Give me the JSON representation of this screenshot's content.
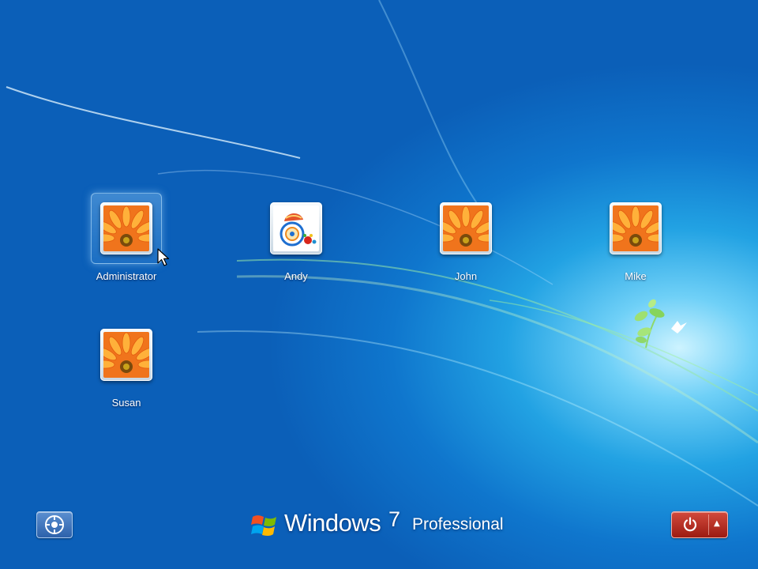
{
  "users": [
    {
      "name": "Administrator",
      "picture": "orange-flower-picture",
      "selected": true
    },
    {
      "name": "Andy",
      "picture": "fish-bowl-picture",
      "selected": false
    },
    {
      "name": "John",
      "picture": "orange-flower-picture",
      "selected": false
    },
    {
      "name": "Mike",
      "picture": "orange-flower-picture",
      "selected": false
    },
    {
      "name": "Susan",
      "picture": "orange-flower-picture",
      "selected": false
    }
  ],
  "branding": {
    "windows": "Windows",
    "version": "7",
    "edition": "Professional"
  },
  "buttons": {
    "ease_of_access_icon": "ease-of-access-icon",
    "shutdown_icon": "power-icon",
    "shutdown_options_icon": "triangle-up-icon",
    "shutdown_options_glyph": "▲"
  },
  "colors": {
    "background": "#0f76cd",
    "power_button": "#b5271b"
  }
}
